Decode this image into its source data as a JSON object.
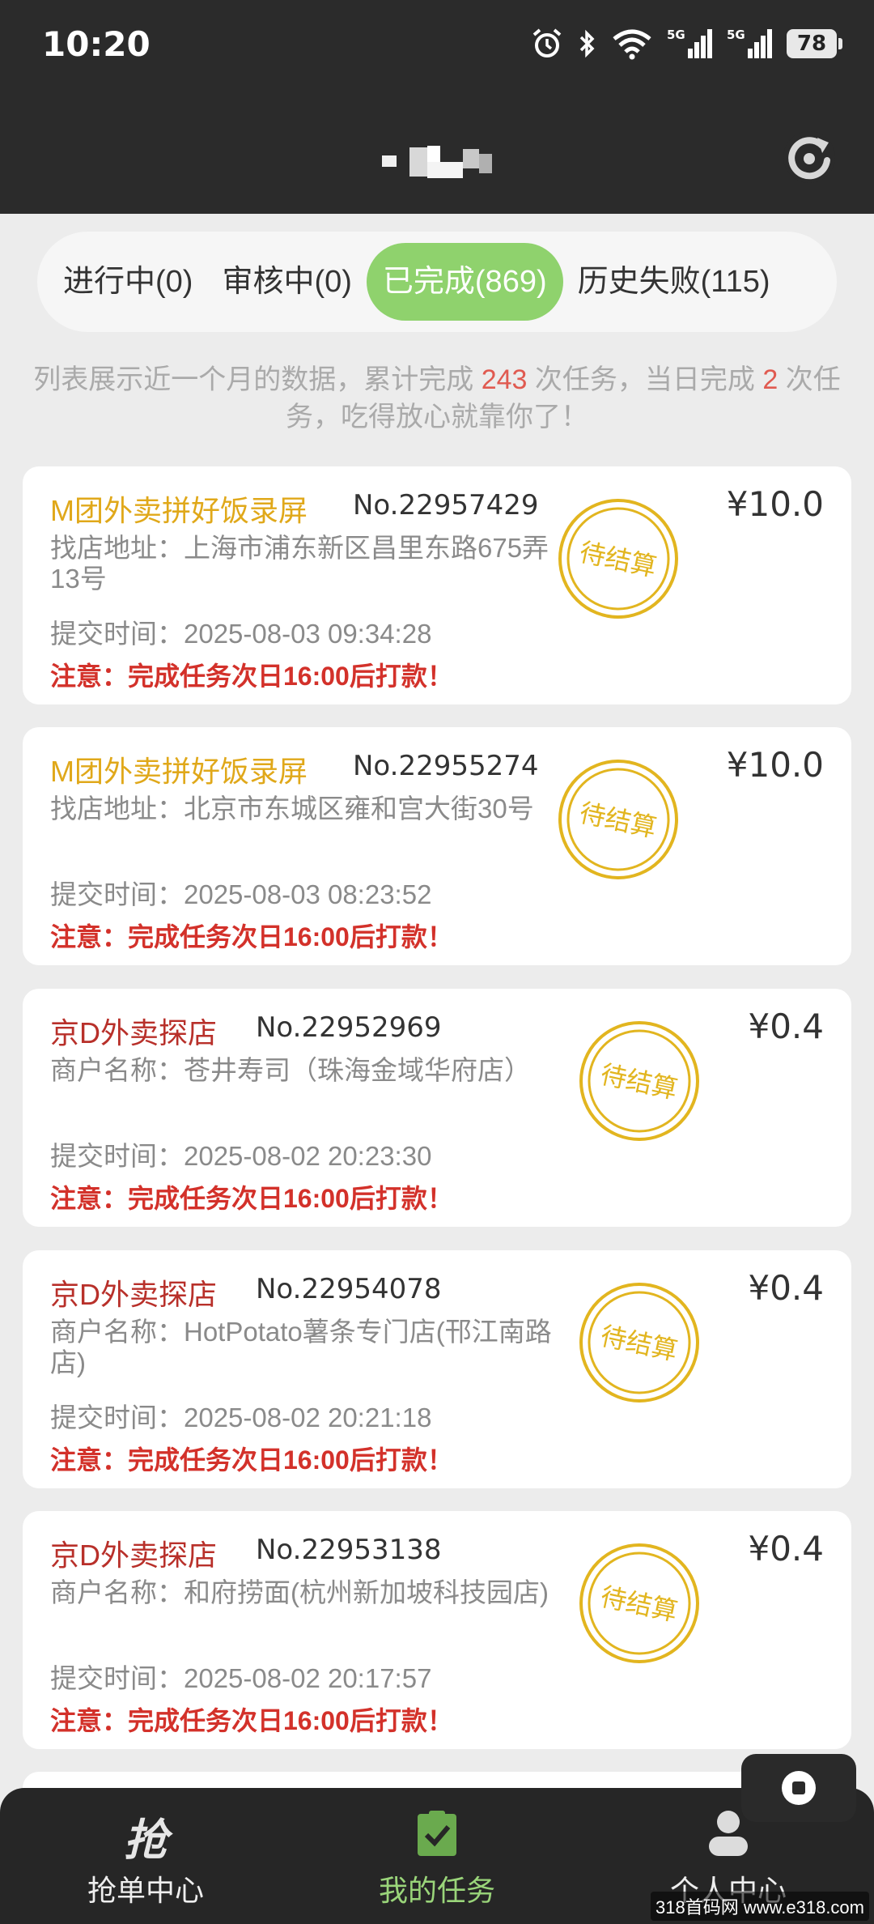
{
  "status": {
    "time": "10:20",
    "battery": "78",
    "network1": "5G",
    "network2": "5G"
  },
  "tabs": [
    {
      "label": "进行中(0)",
      "active": false
    },
    {
      "label": "审核中(0)",
      "active": false
    },
    {
      "label": "已完成(869)",
      "active": true
    },
    {
      "label": "历史失败(115)",
      "active": false
    }
  ],
  "notice": {
    "part1": "列表展示近一个月的数据，累计完成 ",
    "total": "243",
    "part2": " 次任务，当日完成 ",
    "today": "2",
    "part3": " 次任务，吃得放心就靠你了！"
  },
  "cards": [
    {
      "title": "M团外卖拼好饭录屏",
      "no": "No.22957429",
      "price": "¥10.0",
      "label": "找店地址：",
      "value": "上海市浦东新区昌里东路675弄13号",
      "time": "提交时间：2025-08-03 09:34:28",
      "warn": "注意：完成任务次日16:00后打款！",
      "stamp": "待结算"
    },
    {
      "title": "M团外卖拼好饭录屏",
      "no": "No.22955274",
      "price": "¥10.0",
      "label": "找店地址：",
      "value": "北京市东城区雍和宫大街30号",
      "time": "提交时间：2025-08-03 08:23:52",
      "warn": "注意：完成任务次日16:00后打款！",
      "stamp": "待结算"
    },
    {
      "title": "京D外卖探店",
      "no": "No.22952969",
      "price": "¥0.4",
      "label": "商户名称：",
      "value": "苍井寿司（珠海金域华府店）",
      "time": "提交时间：2025-08-02 20:23:30",
      "warn": "注意：完成任务次日16:00后打款！",
      "stamp": "待结算"
    },
    {
      "title": "京D外卖探店",
      "no": "No.22954078",
      "price": "¥0.4",
      "label": "商户名称：",
      "value": "HotPotato薯条专门店(邗江南路店)",
      "time": "提交时间：2025-08-02 20:21:18",
      "warn": "注意：完成任务次日16:00后打款！",
      "stamp": "待结算"
    },
    {
      "title": "京D外卖探店",
      "no": "No.22953138",
      "price": "¥0.4",
      "label": "商户名称：",
      "value": "和府捞面(杭州新加坡科技园店)",
      "time": "提交时间：2025-08-02 20:17:57",
      "warn": "注意：完成任务次日16:00后打款！",
      "stamp": "待结算"
    }
  ],
  "nav": [
    {
      "label": "抢单中心",
      "icon_text": "抢",
      "active": false
    },
    {
      "label": "我的任务",
      "active": true
    },
    {
      "label": "个人中心",
      "active": false
    }
  ],
  "watermark": "318首码网 www.e318.com",
  "colors": {
    "accent": "#8fd26d",
    "warn": "#d3312a",
    "stamp": "#e2b51f",
    "title_yellow": "#e0a81a",
    "title_red": "#b8302a"
  }
}
